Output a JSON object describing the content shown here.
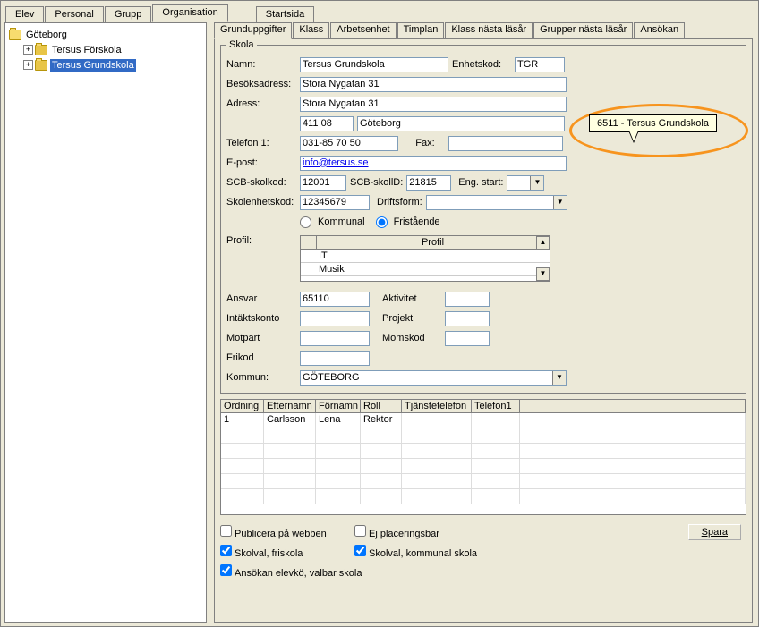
{
  "top_tabs": [
    "Elev",
    "Personal",
    "Grupp",
    "Organisation"
  ],
  "top_tab_active": 3,
  "top_tabs2": [
    "Startsida"
  ],
  "tree": {
    "root": "Göteborg",
    "children": [
      {
        "label": "Tersus Förskola",
        "selected": false
      },
      {
        "label": "Tersus Grundskola",
        "selected": true
      }
    ]
  },
  "inner_tabs": [
    "Grunduppgifter",
    "Klass",
    "Arbetsenhet",
    "Timplan",
    "Klass nästa läsår",
    "Grupper nästa läsår",
    "Ansökan"
  ],
  "inner_tab_active": 0,
  "skola": {
    "legend": "Skola",
    "labels": {
      "namn": "Namn:",
      "enhetskod": "Enhetskod:",
      "besoksadress": "Besöksadress:",
      "adress": "Adress:",
      "telefon1": "Telefon 1:",
      "fax": "Fax:",
      "epost": "E-post:",
      "scb_skolkod": "SCB-skolkod:",
      "scb_skollD": "SCB-skollD:",
      "eng_start": "Eng. start:",
      "skolenhetskod": "Skolenhetskod:",
      "driftsform": "Driftsform:",
      "profil": "Profil:",
      "ansvar": "Ansvar",
      "aktivitet": "Aktivitet",
      "intaktskonto": "Intäktskonto",
      "projekt": "Projekt",
      "motpart": "Motpart",
      "momskod": "Momskod",
      "frikod": "Frikod",
      "kommun": "Kommun:"
    },
    "values": {
      "namn": "Tersus Grundskola",
      "enhetskod": "TGR",
      "besoksadress": "Stora Nygatan 31",
      "adress": "Stora Nygatan 31",
      "postnr": "411 08",
      "ort": "Göteborg",
      "telefon1": "031-85 70 50",
      "fax": "",
      "epost": "info@tersus.se",
      "scb_skolkod": "12001",
      "scb_skollD": "21815",
      "eng_start": "",
      "skolenhetskod": "12345679",
      "driftsform": "",
      "ansvar": "65110",
      "aktivitet": "",
      "intaktskonto": "",
      "projekt": "",
      "motpart": "",
      "momskod": "",
      "frikod": "",
      "kommun": "GÖTEBORG"
    },
    "radio": {
      "kommunal": "Kommunal",
      "fristaende": "Fristående",
      "selected": "fristaende"
    },
    "profile": {
      "header_blank": "",
      "header_profil": "Profil",
      "rows": [
        "IT",
        "Musik"
      ]
    }
  },
  "grid": {
    "headers": [
      "Ordning",
      "Efternamn",
      "Förnamn",
      "Roll",
      "Tjänstetelefon",
      "Telefon1"
    ],
    "rows": [
      {
        "ordning": "1",
        "efternamn": "Carlsson",
        "fornamn": "Lena",
        "roll": "Rektor",
        "tjtel": "",
        "tel1": ""
      }
    ]
  },
  "checkboxes": {
    "publicera": {
      "label": "Publicera på webben",
      "checked": false
    },
    "ejplacer": {
      "label": "Ej placeringsbar",
      "checked": false
    },
    "skolval_fri": {
      "label": "Skolval, friskola",
      "checked": true
    },
    "skolval_kom": {
      "label": "Skolval, kommunal skola",
      "checked": true
    },
    "ansokan": {
      "label": "Ansökan elevkö, valbar skola",
      "checked": true
    }
  },
  "buttons": {
    "spara": "Spara"
  },
  "callout": "6511 - Tersus Grundskola"
}
